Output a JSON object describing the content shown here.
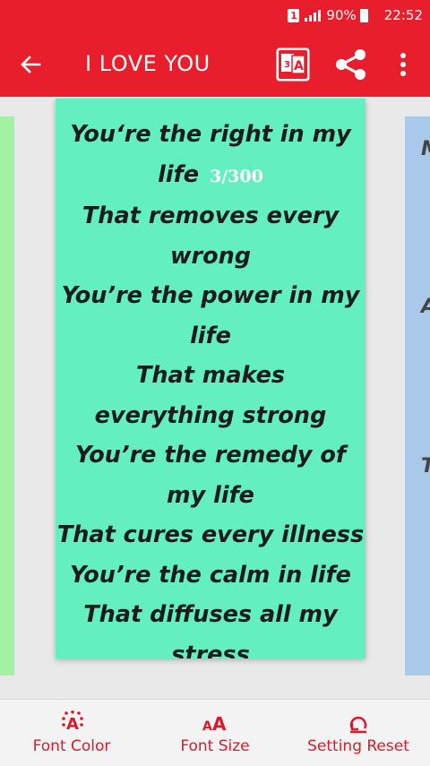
{
  "status_bar": {
    "sim": "1",
    "battery": "90%",
    "time": "22:52"
  },
  "app_bar": {
    "title": "I LOVE YOU",
    "translate_icon": "translate-icon",
    "share_icon": "share-icon",
    "more_icon": "more-vert-icon"
  },
  "colors": {
    "accent": "#e91e2d",
    "card": "#63efbf",
    "left_card": "#a3f2a3",
    "right_card": "#a9c9ea"
  },
  "poem": {
    "counter": "3/300",
    "lines": [
      "You‘re the right in my",
      "life",
      "That removes every",
      "wrong",
      "You’re the power in my",
      "life",
      "That makes",
      "everything strong",
      "You’re the remedy of",
      "my life",
      "That cures every illness",
      "You’re the calm in life",
      "That diffuses all my",
      "stress"
    ]
  },
  "right_card_letters": [
    "M",
    "A",
    "T"
  ],
  "toolbar": {
    "font_color_label": "Font Color",
    "font_size_label": "Font Size",
    "setting_reset_label": "Setting Reset"
  }
}
